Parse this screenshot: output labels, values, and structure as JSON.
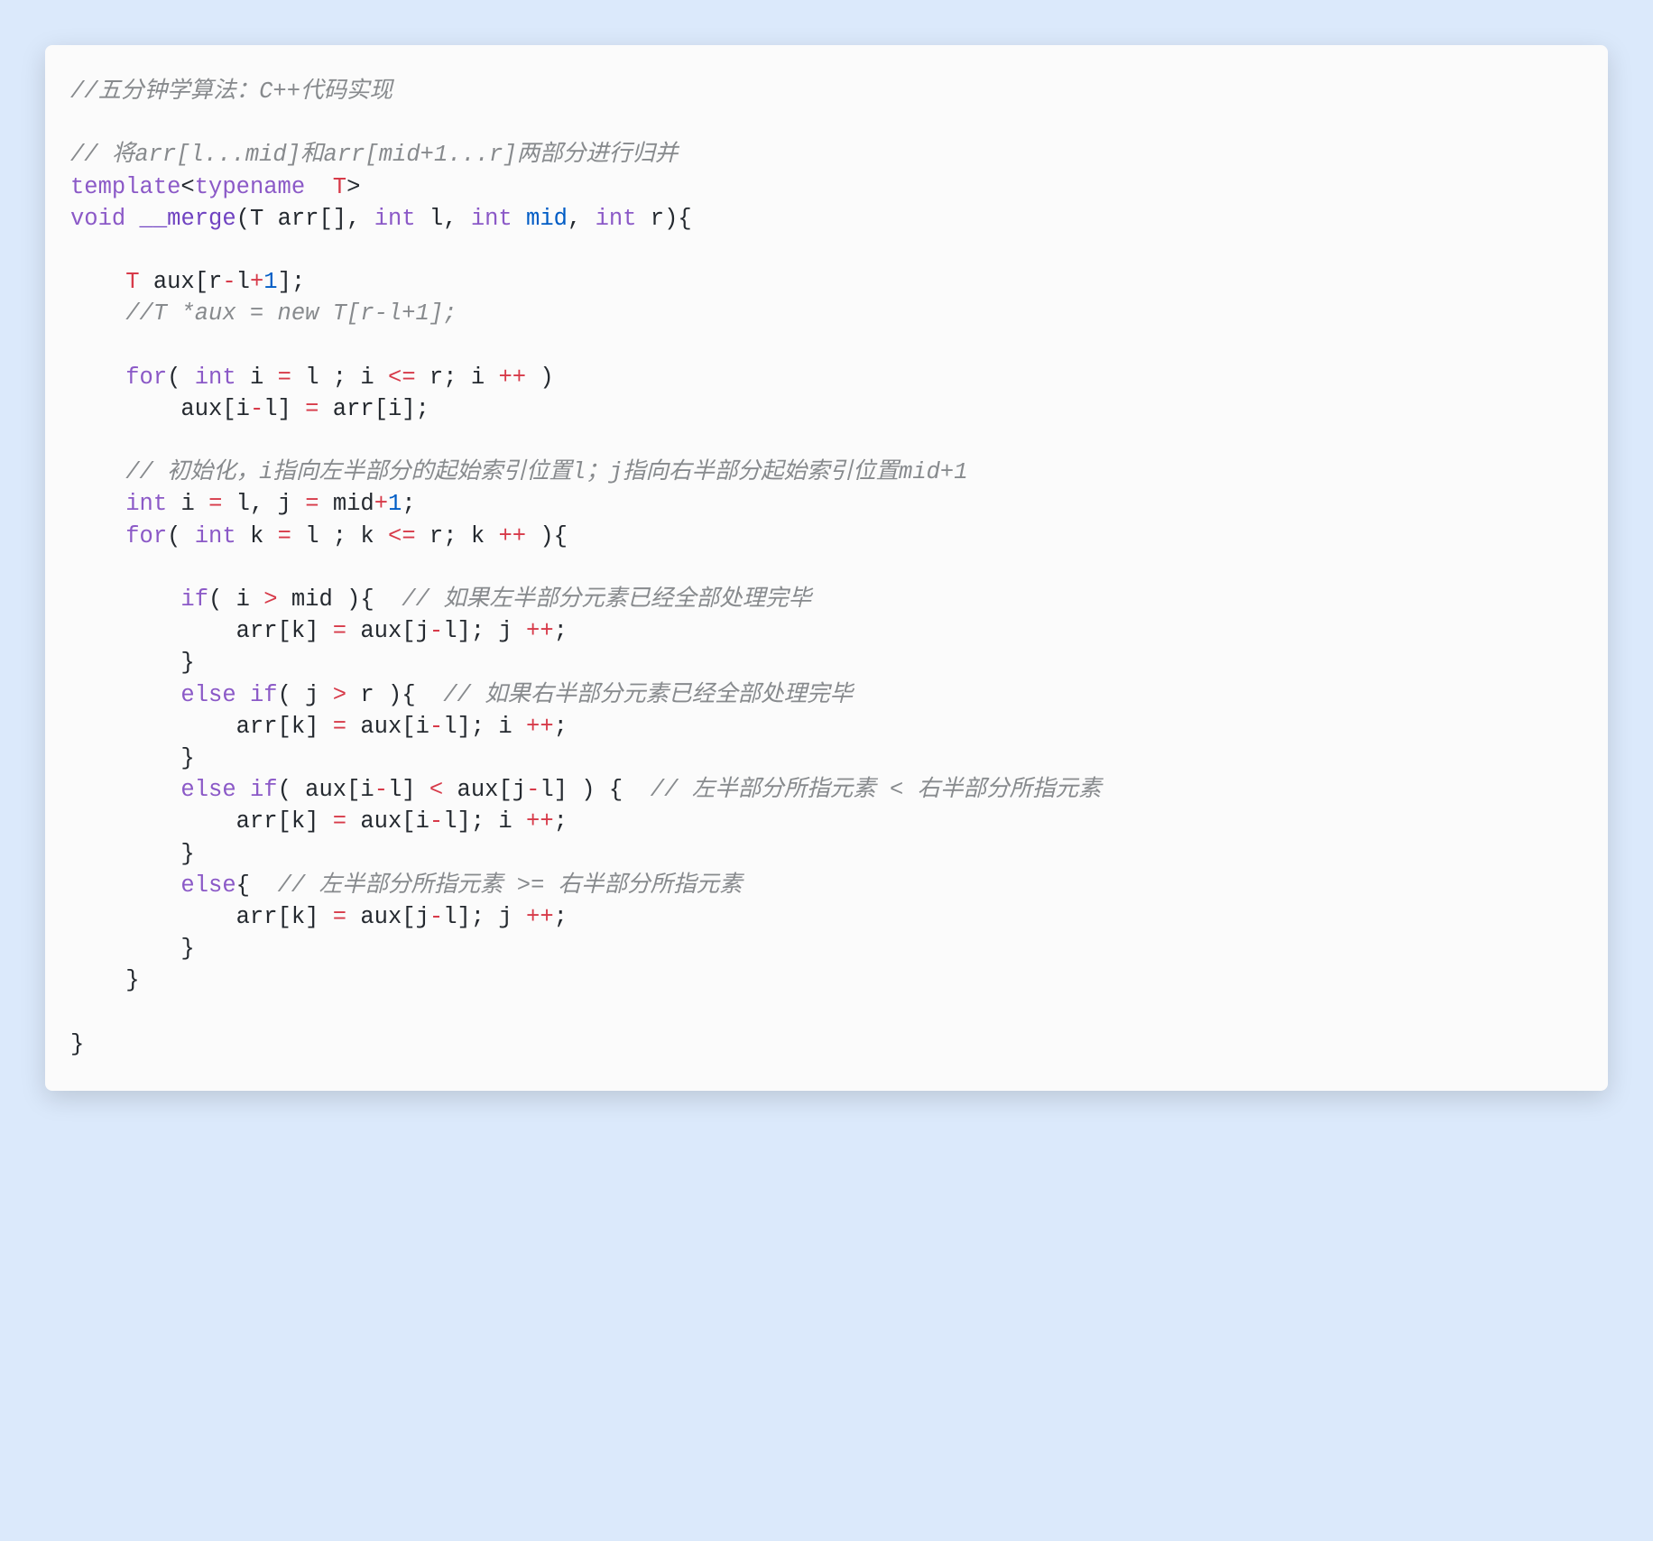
{
  "colors": {
    "page_bg": "#dbe9fb",
    "card_bg": "#fbfbfb",
    "comment": "#878a8d",
    "keyword": "#8b59c7",
    "type_red": "#d73a49",
    "funcname": "#6f42c1",
    "number_blue": "#005cc5",
    "text": "#24292f"
  },
  "code": {
    "l1": "//五分钟学算法：C++代码实现",
    "l3": "// 将arr[l...mid]和arr[mid+1...r]两部分进行归并",
    "l4_template": "template",
    "l4_typename": "typename",
    "l4_T": "T",
    "l5_void": "void",
    "l5_fn": "__merge",
    "l5_arr": "(T arr[], ",
    "l5_int1": "int",
    "l5_l": " l, ",
    "l5_int2": "int",
    "l5_mid": " mid",
    "l5_comma": ", ",
    "l5_int3": "int",
    "l5_r": " r){",
    "l7_T": "    T ",
    "l7_aux": "aux[r",
    "l7_minus": "-",
    "l7_l": "l",
    "l7_plus": "+",
    "l7_one": "1",
    "l7_end": "];",
    "l8": "    //T *aux = new T[r-l+1];",
    "l10_for": "    for",
    "l10_open": "( ",
    "l10_int": "int",
    "l10_i": " i ",
    "l10_eq": "= ",
    "l10_l": "l",
    "l10_sc": " ; i ",
    "l10_le": "<=",
    "l10_r": " r; i ",
    "l10_pp": "++",
    "l10_close": " )",
    "l11_indent": "        ",
    "l11_aux": "aux[i",
    "l11_minus": "-",
    "l11_l": "l] ",
    "l11_eq": "=",
    "l11_arr": " arr[i];",
    "l13": "    // 初始化，i指向左半部分的起始索引位置l；j指向右半部分起始索引位置mid+1",
    "l14_indent": "    ",
    "l14_int": "int",
    "l14_ieq": " i ",
    "l14_eq1": "= ",
    "l14_l": "l",
    "l14_cj": ", j ",
    "l14_eq2": "= ",
    "l14_mid": "mid",
    "l14_plus": "+",
    "l14_one": "1",
    "l14_sc": ";",
    "l15_for": "    for",
    "l15_open": "( ",
    "l15_int": "int",
    "l15_k": " k ",
    "l15_eq": "= ",
    "l15_l": "l",
    "l15_sc": " ; k ",
    "l15_le": "<=",
    "l15_r": " r; k ",
    "l15_pp": "++",
    "l15_close": " ){",
    "l17_if": "        if",
    "l17_cond": "( i ",
    "l17_gt": ">",
    "l17_mid": " mid ",
    "l17_close": "){  ",
    "l17_cmt": "// 如果左半部分元素已经全部处理完毕",
    "l18_indent": "            arr[k] ",
    "l18_eq": "=",
    "l18_aux": " aux[j",
    "l18_minus": "-",
    "l18_l": "l]; j ",
    "l18_pp": "++",
    "l18_sc": ";",
    "l19": "        }",
    "l20_else": "        else",
    "l20_if": " if",
    "l20_cond": "( j ",
    "l20_gt": ">",
    "l20_r": " r ",
    "l20_close": "){  ",
    "l20_cmt": "// 如果右半部分元素已经全部处理完毕",
    "l21_indent": "            arr[k] ",
    "l21_eq": "=",
    "l21_aux": " aux[i",
    "l21_minus": "-",
    "l21_l": "l]; i ",
    "l21_pp": "++",
    "l21_sc": ";",
    "l22": "        }",
    "l23_else": "        else",
    "l23_if": " if",
    "l23_open": "( aux[i",
    "l23_minus1": "-",
    "l23_l1": "l] ",
    "l23_lt": "<",
    "l23_aux2": " aux[j",
    "l23_minus2": "-",
    "l23_l2": "l] ) {  ",
    "l23_cmt": "// 左半部分所指元素 < 右半部分所指元素",
    "l24_indent": "            arr[k] ",
    "l24_eq": "=",
    "l24_aux": " aux[i",
    "l24_minus": "-",
    "l24_l": "l]; i ",
    "l24_pp": "++",
    "l24_sc": ";",
    "l25": "        }",
    "l26_else": "        else",
    "l26_open": "{  ",
    "l26_cmt": "// 左半部分所指元素 >= 右半部分所指元素",
    "l27_indent": "            arr[k] ",
    "l27_eq": "=",
    "l27_aux": " aux[j",
    "l27_minus": "-",
    "l27_l": "l]; j ",
    "l27_pp": "++",
    "l27_sc": ";",
    "l28": "        }",
    "l29": "    }",
    "l31": "}"
  }
}
